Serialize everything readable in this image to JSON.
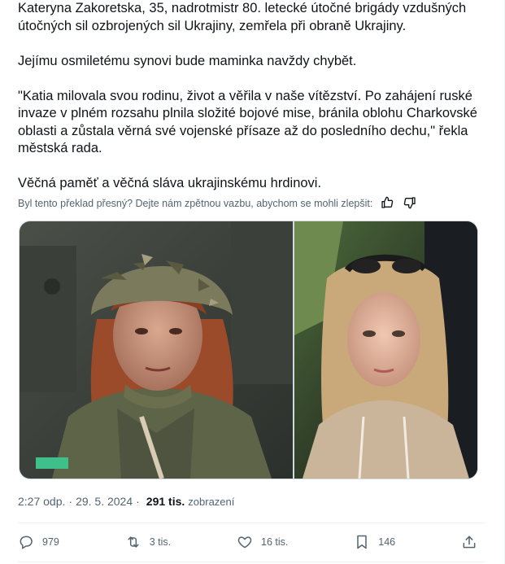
{
  "post": {
    "paragraphs": [
      "Kateryna Zakoretska, 35, nadrotmistr 80. letecké útočné brigády vzdušných útočných sil ozbrojených sil Ukrajiny, zemřela při obraně Ukrajiny.",
      "Jejímu osmiletému synovi bude maminka navždy chybět.",
      "\"Katia milovala svou rodinu, život a věřila v naše vítězství. Po zahájení ruské invaze v plném rozsahu plnila složité bojové mise, bránila oblohu Charkovské oblasti a zůstala věrná své vojenské přísaze až do posledního dechu,\" řekla městská rada.",
      "Věčná paměť a věčná sláva ukrajinskému hrdinovi."
    ],
    "feedback_question": "Byl tento překlad přesný? Dejte nám zpětnou vazbu, abychom se mohli zlepšit:",
    "feedback_icons": [
      "thumbs-up-icon",
      "thumbs-down-icon"
    ],
    "time": "2:27 odp.",
    "date": "29. 5. 2024",
    "views_count": "291 tis.",
    "views_label": "zobrazení",
    "separator": "·"
  },
  "actions": {
    "replies": "979",
    "reposts": "3 tis.",
    "likes": "16 tis.",
    "bookmarks": "146",
    "icons": [
      "reply-icon",
      "repost-icon",
      "like-icon",
      "bookmark-icon",
      "share-icon"
    ]
  },
  "colors": {
    "text": "#0f1419",
    "secondary": "#536471",
    "border": "#cfd9de"
  }
}
